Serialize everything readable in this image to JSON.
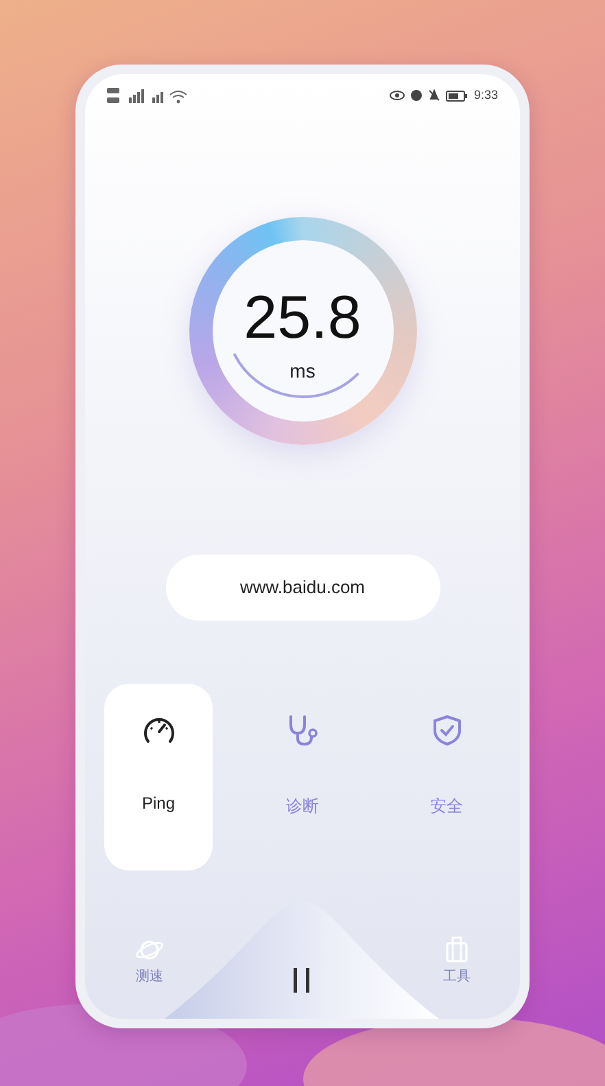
{
  "status_bar": {
    "time": "9:33"
  },
  "gauge": {
    "value": "25.8",
    "unit": "ms"
  },
  "host": {
    "value": "www.baidu.com"
  },
  "tabs": [
    {
      "label": "Ping",
      "kind": "speedometer",
      "selected": true
    },
    {
      "label": "诊断",
      "kind": "stethoscope",
      "selected": false
    },
    {
      "label": "安全",
      "kind": "shield",
      "selected": false
    }
  ],
  "bottom_nav": [
    {
      "label": "测速",
      "kind": "planet"
    },
    {
      "label": "工具",
      "kind": "bag"
    }
  ]
}
